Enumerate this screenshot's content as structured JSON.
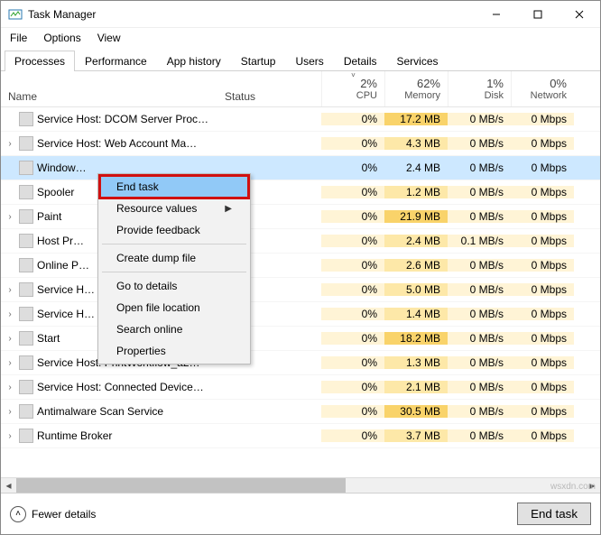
{
  "window": {
    "title": "Task Manager"
  },
  "menus": [
    "File",
    "Options",
    "View"
  ],
  "tabs": [
    "Processes",
    "Performance",
    "App history",
    "Startup",
    "Users",
    "Details",
    "Services"
  ],
  "active_tab_index": 0,
  "columns": {
    "name": "Name",
    "status": "Status",
    "cpu": {
      "pct": "2%",
      "label": "CPU"
    },
    "memory": {
      "pct": "62%",
      "label": "Memory"
    },
    "disk": {
      "pct": "1%",
      "label": "Disk"
    },
    "network": {
      "pct": "0%",
      "label": "Network"
    }
  },
  "rows": [
    {
      "exp": false,
      "name": "Service Host: DCOM Server Proc…",
      "cpu": "0%",
      "mem": "17.2 MB",
      "disk": "0 MB/s",
      "net": "0 Mbps"
    },
    {
      "exp": true,
      "name": "Service Host: Web Account Ma…",
      "cpu": "0%",
      "mem": "4.3 MB",
      "disk": "0 MB/s",
      "net": "0 Mbps"
    },
    {
      "exp": false,
      "name": "Window…",
      "cpu": "0%",
      "mem": "2.4 MB",
      "disk": "0 MB/s",
      "net": "0 Mbps",
      "selected": true
    },
    {
      "exp": false,
      "name": "Spooler",
      "cpu": "0%",
      "mem": "1.2 MB",
      "disk": "0 MB/s",
      "net": "0 Mbps"
    },
    {
      "exp": true,
      "name": "Paint",
      "cpu": "0%",
      "mem": "21.9 MB",
      "disk": "0 MB/s",
      "net": "0 Mbps"
    },
    {
      "exp": false,
      "name": "Host Pr…",
      "cpu": "0%",
      "mem": "2.4 MB",
      "disk": "0.1 MB/s",
      "net": "0 Mbps"
    },
    {
      "exp": false,
      "name": "Online P…",
      "cpu": "0%",
      "mem": "2.6 MB",
      "disk": "0 MB/s",
      "net": "0 Mbps"
    },
    {
      "exp": true,
      "name": "Service H…",
      "cpu": "0%",
      "mem": "5.0 MB",
      "disk": "0 MB/s",
      "net": "0 Mbps"
    },
    {
      "exp": true,
      "name": "Service H…",
      "cpu": "0%",
      "mem": "1.4 MB",
      "disk": "0 MB/s",
      "net": "0 Mbps"
    },
    {
      "exp": true,
      "name": "Start",
      "cpu": "0%",
      "mem": "18.2 MB",
      "disk": "0 MB/s",
      "net": "0 Mbps"
    },
    {
      "exp": true,
      "name": "Service Host: PrintWorkflow_a2…",
      "cpu": "0%",
      "mem": "1.3 MB",
      "disk": "0 MB/s",
      "net": "0 Mbps"
    },
    {
      "exp": true,
      "name": "Service Host: Connected Device…",
      "cpu": "0%",
      "mem": "2.1 MB",
      "disk": "0 MB/s",
      "net": "0 Mbps"
    },
    {
      "exp": true,
      "name": "Antimalware Scan Service",
      "cpu": "0%",
      "mem": "30.5 MB",
      "disk": "0 MB/s",
      "net": "0 Mbps"
    },
    {
      "exp": true,
      "name": "Runtime Broker",
      "cpu": "0%",
      "mem": "3.7 MB",
      "disk": "0 MB/s",
      "net": "0 Mbps"
    }
  ],
  "context_menu": {
    "items": [
      {
        "label": "End task",
        "highlight": true
      },
      {
        "label": "Resource values",
        "submenu": true
      },
      {
        "label": "Provide feedback"
      },
      {
        "sep": true
      },
      {
        "label": "Create dump file"
      },
      {
        "sep": true
      },
      {
        "label": "Go to details"
      },
      {
        "label": "Open file location"
      },
      {
        "label": "Search online"
      },
      {
        "label": "Properties"
      }
    ]
  },
  "footer": {
    "fewer": "Fewer details",
    "end_task": "End task"
  },
  "watermark": "wsxdn.com"
}
